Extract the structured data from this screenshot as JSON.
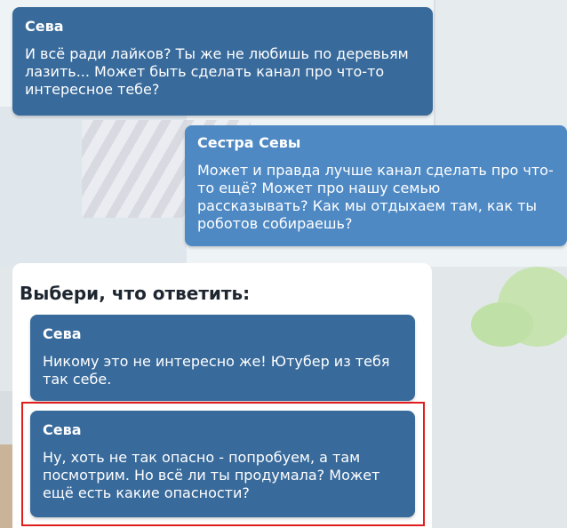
{
  "messages": [
    {
      "name": "Сева",
      "text": "И всё ради лайков? Ты же не любишь по деревьям лазить... Может быть сделать канал про что-то интересное тебе?"
    },
    {
      "name": "Сестра Севы",
      "text": "Может и правда лучше канал сделать про что-то ещё? Может про нашу семью рассказывать? Как мы отдыхаем там, как ты роботов собираешь?"
    }
  ],
  "choice_panel": {
    "title": "Выбери, что ответить:",
    "options": [
      {
        "name": "Сева",
        "text": "Никому это не интересно же! Ютубер из тебя так себе."
      },
      {
        "name": "Сева",
        "text": "Ну, хоть не так опасно - попробуем, а там посмотрим. Но всё ли ты продумала? Может ещё есть какие опасности?"
      }
    ]
  },
  "colors": {
    "bubble_sender": "#386a9b",
    "bubble_receiver": "#4e89c4",
    "highlight": "#e01c1c"
  }
}
